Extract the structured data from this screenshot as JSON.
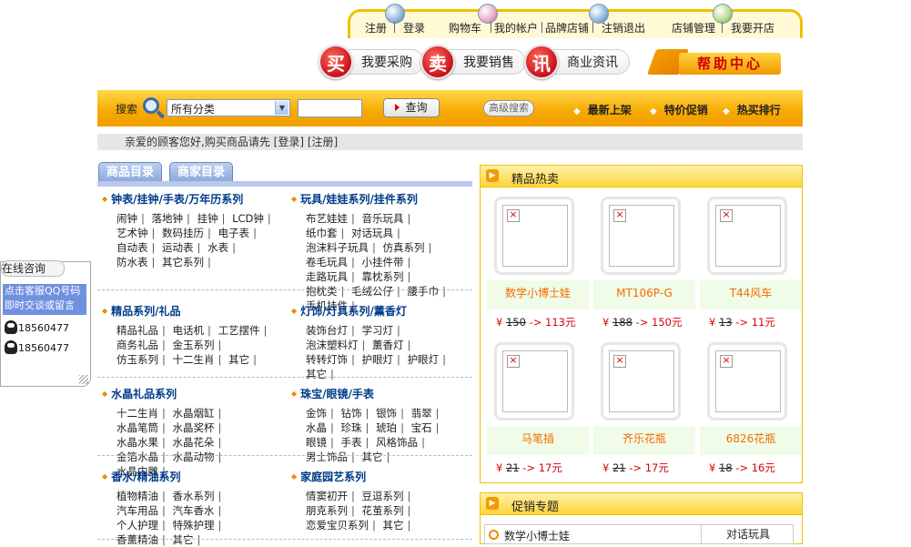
{
  "topnav": {
    "links": [
      "注册",
      "登录",
      "购物车",
      "我的帐户",
      "品牌店铺",
      "注销退出",
      "店铺管理",
      "我要开店"
    ]
  },
  "bigbuttons": [
    {
      "char": "买",
      "label": "我要采购"
    },
    {
      "char": "卖",
      "label": "我要销售"
    },
    {
      "char": "讯",
      "label": "商业资讯"
    }
  ],
  "help": {
    "label": "帮助中心"
  },
  "search": {
    "label": "搜索",
    "category_selected": "所有分类",
    "query_button": "查询",
    "advanced": "高级搜索",
    "quick": [
      "最新上架",
      "特价促销",
      "热买排行"
    ]
  },
  "welcome": {
    "text": "亲爱的顾客您好,购买商品请先",
    "login": "[登录]",
    "register": "[注册]"
  },
  "tabs": [
    "商品目录",
    "商家目录"
  ],
  "categories": [
    {
      "title": "钟表/挂钟/手表/万年历系列",
      "items": [
        "闹钟",
        "落地钟",
        "挂钟",
        "LCD钟",
        "艺术钟",
        "数码挂历",
        "电子表",
        "自动表",
        "运动表",
        "水表",
        "防水表",
        "其它系列"
      ]
    },
    {
      "title": "玩具/娃娃系列/挂件系列",
      "items": [
        "布艺娃娃",
        "音乐玩具",
        "纸巾套",
        "对话玩具",
        "泡沫料子玩具",
        "仿真系列",
        "卷毛玩具",
        "小挂件带",
        "走路玩具",
        "靠枕系列",
        "抱枕类",
        "毛绒公仔",
        "腰手巾",
        "手机挂件"
      ]
    },
    {
      "title": "精品系列/礼品",
      "items": [
        "精品礼品",
        "电话机",
        "工艺摆件",
        "商务礼品",
        "金玉系列",
        "仿玉系列",
        "十二生肖",
        "其它"
      ]
    },
    {
      "title": "灯饰/灯具系列/薰香灯",
      "items": [
        "装饰台灯",
        "学习灯",
        "泡沫塑料灯",
        "薰香灯",
        "转转灯饰",
        "护眼灯",
        "护眼灯",
        "其它"
      ]
    },
    {
      "title": "水晶礼品系列",
      "items": [
        "十二生肖",
        "水晶烟缸",
        "水晶笔筒",
        "水晶奖杯",
        "水晶水果",
        "水晶花朵",
        "金箔水晶",
        "水晶动物",
        "水晶内雕"
      ]
    },
    {
      "title": "珠宝/眼镜/手表",
      "items": [
        "金饰",
        "钻饰",
        "银饰",
        "翡翠",
        "水晶",
        "珍珠",
        "琥珀",
        "宝石",
        "眼镜",
        "手表",
        "风格饰品",
        "男士饰品",
        "其它"
      ]
    },
    {
      "title": "香水/精油系列",
      "items": [
        "植物精油",
        "香水系列",
        "汽车用品",
        "汽车香水",
        "个人护理",
        "特殊护理",
        "香薰精油",
        "其它"
      ]
    },
    {
      "title": "家庭园艺系列",
      "items": [
        "情窦初开",
        "豆逗系列",
        "朋克系列",
        "花茧系列",
        "恋爱宝贝系列",
        "其它"
      ]
    }
  ],
  "qq": {
    "header": "在线咨询",
    "notice": "点击客服QQ号码即时交谈或留言",
    "numbers": [
      "18560477",
      "18560477"
    ]
  },
  "hot": {
    "title": "精品热卖",
    "products": [
      {
        "name": "数学小博士娃",
        "currency": "¥",
        "old": "150",
        "arrow": "->",
        "new": "113元"
      },
      {
        "name": "MT106P-G",
        "currency": "¥",
        "old": "188",
        "arrow": "->",
        "new": "150元"
      },
      {
        "name": "T44风车",
        "currency": "¥",
        "old": "13",
        "arrow": "->",
        "new": "11元"
      },
      {
        "name": "马笔插",
        "currency": "¥",
        "old": "21",
        "arrow": "->",
        "new": "17元"
      },
      {
        "name": "齐乐花瓶",
        "currency": "¥",
        "old": "21",
        "arrow": "->",
        "new": "17元"
      },
      {
        "name": "6826花瓶",
        "currency": "¥",
        "old": "18",
        "arrow": "->",
        "new": "16元"
      }
    ]
  },
  "promo": {
    "title": "促销专题",
    "row": {
      "left": "数学小博士娃",
      "right": "对话玩具"
    }
  },
  "colors": {
    "accent": "#f3a000",
    "link_blue": "#003c8a",
    "price_red": "#d6000d",
    "name_orange": "#f26c00"
  }
}
